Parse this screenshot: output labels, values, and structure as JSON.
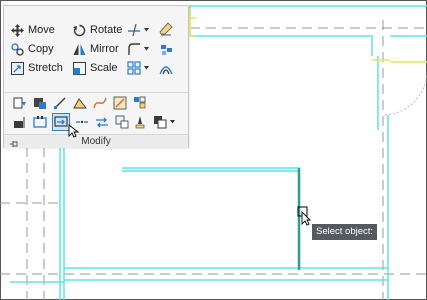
{
  "ribbon": {
    "panel_title": "Modify",
    "tools": {
      "move": "Move",
      "rotate": "Rotate",
      "copy": "Copy",
      "mirror": "Mirror",
      "stretch": "Stretch",
      "scale": "Scale"
    },
    "icons": [
      "trim-extend-icon",
      "erase-icon",
      "fillet-icon",
      "explode-icon",
      "array-icon",
      "offset-icon",
      "copy-properties-icon",
      "lengthen-icon",
      "break-icon",
      "edit-polyline-icon",
      "blend-curves-icon",
      "spline-icon",
      "rubber-stamp-icon",
      "block-icon",
      "align-icon",
      "join-icon",
      "break-at-point-icon",
      "edit-attribute-icon",
      "reverse-icon",
      "boundary-icon",
      "draw-order-icon",
      "pin-icon"
    ]
  },
  "drawing": {
    "tooltip_text": "Select object:",
    "colors": {
      "wall_cyan": "#5be5e5",
      "wall_teal": "#2d9c9c",
      "dashed_gray": "#9a9a9a",
      "yellow_line": "#e6e65c"
    }
  }
}
